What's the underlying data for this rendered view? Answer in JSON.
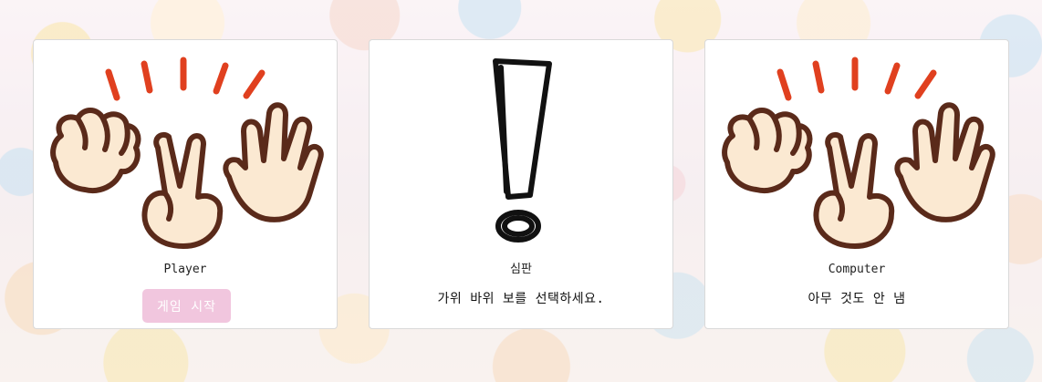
{
  "player": {
    "name": "Player",
    "start_button_label": "게임 시작"
  },
  "judge": {
    "name": "심판",
    "message": "가위 바위 보를 선택하세요."
  },
  "computer": {
    "name": "Computer",
    "status": "아무 것도 안 냄"
  },
  "icons": {
    "player_art": "rock-paper-scissors-hands-icon",
    "judge_art": "exclamation-mark-icon",
    "computer_art": "rock-paper-scissors-hands-icon"
  },
  "colors": {
    "card_background": "#ffffff",
    "start_button": "#f1c6de",
    "start_button_text": "#ffffff",
    "hand_outline": "#5a2a1a",
    "hand_fill": "#fbe9d2",
    "accent_red": "#e0401f"
  }
}
